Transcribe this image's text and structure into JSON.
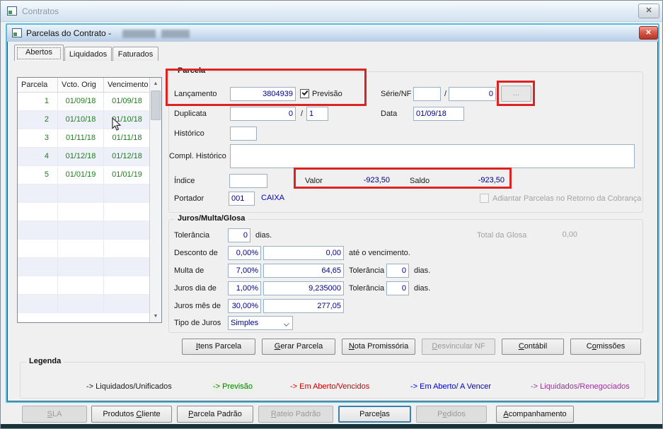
{
  "colors": {
    "annotation_red": "#dd2222",
    "value_navy": "#000080",
    "table_green": "#1e7d1e",
    "portador_blue": "#0000cc"
  },
  "outer_window": {
    "title": "Contratos",
    "close_glyph": "✕"
  },
  "inner_window": {
    "title": "Parcelas do Contrato -",
    "close_glyph": "✕"
  },
  "tabs": [
    {
      "label": "Abertos"
    },
    {
      "label": "Liquidados"
    },
    {
      "label": "Faturados"
    }
  ],
  "table": {
    "columns": [
      "Parcela",
      "Vcto. Orig",
      "Vencimento"
    ],
    "rows": [
      [
        "1",
        "01/09/18",
        "01/09/18"
      ],
      [
        "2",
        "01/10/18",
        "01/10/18"
      ],
      [
        "3",
        "01/11/18",
        "01/11/18"
      ],
      [
        "4",
        "01/12/18",
        "01/12/18"
      ],
      [
        "5",
        "01/01/19",
        "01/01/19"
      ]
    ],
    "scroll_up_glyph": "▲",
    "scroll_down_glyph": "▼"
  },
  "parcela_group": {
    "title": "Parcela",
    "lancamento_label": "Lançamento",
    "lancamento_value": "3804939",
    "previsao_label": "Previsão",
    "previsao_checked": true,
    "serie_nf_label": "Série/NF",
    "serie_nf_value1": "",
    "serie_nf_separator": "/",
    "serie_nf_value2": "0",
    "browse_label": "...",
    "duplicata_label": "Duplicata",
    "duplicata_value1": "0",
    "duplicata_separator": "/",
    "duplicata_value2": "1",
    "data_label": "Data",
    "data_value": "01/09/18",
    "historico_label": "Histórico",
    "historico_value": "",
    "compl_historico_label": "Compl. Histórico",
    "compl_historico_value": "",
    "indice_label": "Índice",
    "indice_value": "",
    "valor_label": "Valor",
    "valor_value": "-923,50",
    "saldo_label": "Saldo",
    "saldo_value": "-923,50",
    "portador_label": "Portador",
    "portador_value": "001",
    "portador_name": "CAIXA",
    "adiantar_label": "Adiantar Parcelas no Retorno da Cobrança",
    "adiantar_checked": false
  },
  "juros_group": {
    "title": "Juros/Multa/Glosa",
    "tolerancia_label": "Tolerância",
    "tolerancia_value": "0",
    "tolerancia_suffix": "dias.",
    "total_glosa_label": "Total da Glosa",
    "total_glosa_value": "0,00",
    "desconto_label": "Desconto de",
    "desconto_pct": "0,00%",
    "desconto_value": "0,00",
    "desconto_suffix": "até o vencimento.",
    "multa_label": "Multa de",
    "multa_pct": "7,00%",
    "multa_value": "64,65",
    "multa_tol_label": "Tolerância",
    "multa_tol_value": "0",
    "multa_tol_suffix": "dias.",
    "juros_dia_label": "Juros dia de",
    "juros_dia_pct": "1,00%",
    "juros_dia_value": "9,235000",
    "juros_dia_tol_label": "Tolerância",
    "juros_dia_tol_value": "0",
    "juros_dia_tol_suffix": "dias.",
    "juros_mes_label": "Juros mês de",
    "juros_mes_pct": "30,00%",
    "juros_mes_value": "277,05",
    "tipo_juros_label": "Tipo de Juros",
    "tipo_juros_value": "Simples"
  },
  "action_buttons": [
    {
      "pre": "",
      "accel": "I",
      "post": "tens Parcela"
    },
    {
      "pre": "",
      "accel": "G",
      "post": "erar Parcela"
    },
    {
      "pre": "",
      "accel": "N",
      "post": "ota Promissória"
    },
    {
      "pre": "",
      "accel": "D",
      "post": "esvincular NF"
    },
    {
      "pre": "",
      "accel": "C",
      "post": "ontábil"
    },
    {
      "pre": "C",
      "accel": "o",
      "post": "missões"
    }
  ],
  "legend": {
    "title": "Legenda",
    "items": [
      {
        "label": "-> Liquidados/Unificados",
        "color": "#1a1a1a"
      },
      {
        "label": "-> Previsão",
        "color": "#008000"
      },
      {
        "label": "-> Em Aberto/Vencidos",
        "color": "#cc0000"
      },
      {
        "label": "-> Em Aberto/ A Vencer",
        "color": "#0000cc"
      },
      {
        "label": "-> Liquidados/Renegociados",
        "color": "#993399"
      }
    ]
  },
  "bottom_buttons": [
    {
      "pre": "",
      "accel": "S",
      "post": "LA"
    },
    {
      "pre": "Produtos ",
      "accel": "C",
      "post": "liente"
    },
    {
      "pre": "",
      "accel": "P",
      "post": "arcela Padrão"
    },
    {
      "pre": "",
      "accel": "R",
      "post": "ateio Padrão"
    },
    {
      "pre": "Parce",
      "accel": "l",
      "post": "as"
    },
    {
      "pre": "P",
      "accel": "e",
      "post": "didos"
    },
    {
      "pre": "",
      "accel": "A",
      "post": "companhamento"
    }
  ]
}
